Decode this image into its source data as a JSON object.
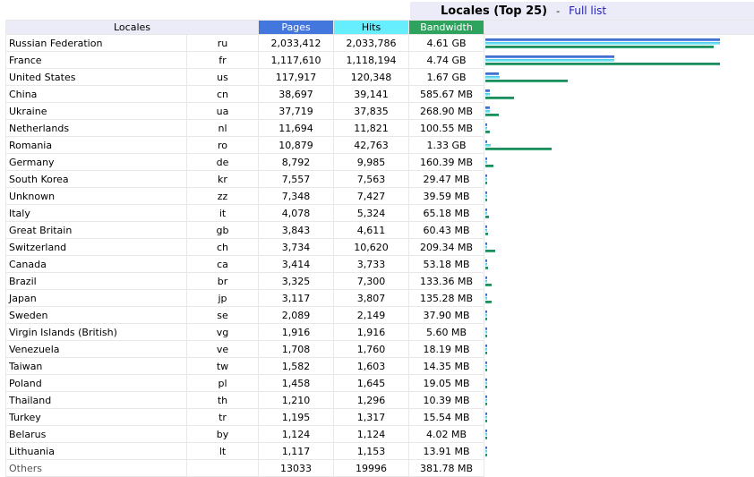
{
  "header": {
    "title": "Locales (Top 25)",
    "separator": "-",
    "full_list_link": "Full list"
  },
  "columns": {
    "locales": "Locales",
    "pages": "Pages",
    "hits": "Hits",
    "bandwidth": "Bandwidth"
  },
  "colors": {
    "pages": "#4477dd",
    "hits": "#66eeff",
    "bandwidth": "#2ea35d"
  },
  "rows": [
    {
      "name": "Russian Federation",
      "code": "ru",
      "pages": "2,033,412",
      "hits": "2,033,786",
      "bandwidth": "4.61 GB"
    },
    {
      "name": "France",
      "code": "fr",
      "pages": "1,117,610",
      "hits": "1,118,194",
      "bandwidth": "4.74 GB"
    },
    {
      "name": "United States",
      "code": "us",
      "pages": "117,917",
      "hits": "120,348",
      "bandwidth": "1.67 GB"
    },
    {
      "name": "China",
      "code": "cn",
      "pages": "38,697",
      "hits": "39,141",
      "bandwidth": "585.67 MB"
    },
    {
      "name": "Ukraine",
      "code": "ua",
      "pages": "37,719",
      "hits": "37,835",
      "bandwidth": "268.90 MB"
    },
    {
      "name": "Netherlands",
      "code": "nl",
      "pages": "11,694",
      "hits": "11,821",
      "bandwidth": "100.55 MB"
    },
    {
      "name": "Romania",
      "code": "ro",
      "pages": "10,879",
      "hits": "42,763",
      "bandwidth": "1.33 GB"
    },
    {
      "name": "Germany",
      "code": "de",
      "pages": "8,792",
      "hits": "9,985",
      "bandwidth": "160.39 MB"
    },
    {
      "name": "South Korea",
      "code": "kr",
      "pages": "7,557",
      "hits": "7,563",
      "bandwidth": "29.47 MB"
    },
    {
      "name": "Unknown",
      "code": "zz",
      "pages": "7,348",
      "hits": "7,427",
      "bandwidth": "39.59 MB"
    },
    {
      "name": "Italy",
      "code": "it",
      "pages": "4,078",
      "hits": "5,324",
      "bandwidth": "65.18 MB"
    },
    {
      "name": "Great Britain",
      "code": "gb",
      "pages": "3,843",
      "hits": "4,611",
      "bandwidth": "60.43 MB"
    },
    {
      "name": "Switzerland",
      "code": "ch",
      "pages": "3,734",
      "hits": "10,620",
      "bandwidth": "209.34 MB"
    },
    {
      "name": "Canada",
      "code": "ca",
      "pages": "3,414",
      "hits": "3,733",
      "bandwidth": "53.18 MB"
    },
    {
      "name": "Brazil",
      "code": "br",
      "pages": "3,325",
      "hits": "7,300",
      "bandwidth": "133.36 MB"
    },
    {
      "name": "Japan",
      "code": "jp",
      "pages": "3,117",
      "hits": "3,807",
      "bandwidth": "135.28 MB"
    },
    {
      "name": "Sweden",
      "code": "se",
      "pages": "2,089",
      "hits": "2,149",
      "bandwidth": "37.90 MB"
    },
    {
      "name": "Virgin Islands (British)",
      "code": "vg",
      "pages": "1,916",
      "hits": "1,916",
      "bandwidth": "5.60 MB"
    },
    {
      "name": "Venezuela",
      "code": "ve",
      "pages": "1,708",
      "hits": "1,760",
      "bandwidth": "18.19 MB"
    },
    {
      "name": "Taiwan",
      "code": "tw",
      "pages": "1,582",
      "hits": "1,603",
      "bandwidth": "14.35 MB"
    },
    {
      "name": "Poland",
      "code": "pl",
      "pages": "1,458",
      "hits": "1,645",
      "bandwidth": "19.05 MB"
    },
    {
      "name": "Thailand",
      "code": "th",
      "pages": "1,210",
      "hits": "1,296",
      "bandwidth": "10.39 MB"
    },
    {
      "name": "Turkey",
      "code": "tr",
      "pages": "1,195",
      "hits": "1,317",
      "bandwidth": "15.54 MB"
    },
    {
      "name": "Belarus",
      "code": "by",
      "pages": "1,124",
      "hits": "1,124",
      "bandwidth": "4.02 MB"
    },
    {
      "name": "Lithuania",
      "code": "lt",
      "pages": "1,117",
      "hits": "1,153",
      "bandwidth": "13.91 MB"
    }
  ],
  "others": {
    "name": "Others",
    "pages": "13033",
    "hits": "19996",
    "bandwidth": "381.78 MB"
  }
}
